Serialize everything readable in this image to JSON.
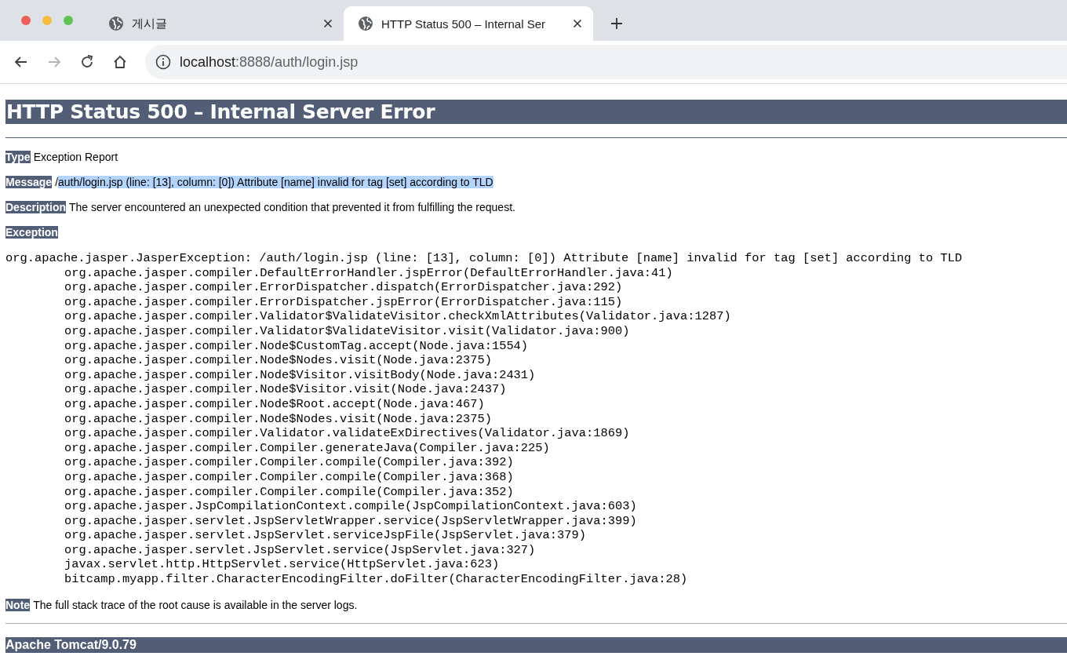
{
  "browser": {
    "tabs": [
      {
        "title": "게시글",
        "selected": false
      },
      {
        "title": "HTTP Status 500 – Internal Ser",
        "selected": true
      }
    ],
    "address": {
      "host": "localhost",
      "path": ":8888/auth/login.jsp"
    }
  },
  "page": {
    "title": "HTTP Status 500 – Internal Server Error",
    "fields": [
      {
        "label": "Type",
        "segments": [
          {
            "text": "Exception Report",
            "selected": false
          }
        ]
      },
      {
        "label": "Message",
        "segments": [
          {
            "text": "/",
            "selected": false
          },
          {
            "text": "auth/login.jsp (line: [13], column: [0]) Attribute [name] invalid for tag [set] according to TLD",
            "selected": true
          }
        ]
      },
      {
        "label": "Description",
        "segments": [
          {
            "text": "The server encountered an unexpected condition that prevented it from fulfilling the request.",
            "selected": false
          }
        ]
      },
      {
        "label": "Exception"
      }
    ],
    "exception": "org.apache.jasper.JasperException: /auth/login.jsp (line: [13], column: [0]) Attribute [name] invalid for tag [set] according to TLD",
    "stack_trace": [
      "org.apache.jasper.compiler.DefaultErrorHandler.jspError(DefaultErrorHandler.java:41)",
      "org.apache.jasper.compiler.ErrorDispatcher.dispatch(ErrorDispatcher.java:292)",
      "org.apache.jasper.compiler.ErrorDispatcher.jspError(ErrorDispatcher.java:115)",
      "org.apache.jasper.compiler.Validator$ValidateVisitor.checkXmlAttributes(Validator.java:1287)",
      "org.apache.jasper.compiler.Validator$ValidateVisitor.visit(Validator.java:900)",
      "org.apache.jasper.compiler.Node$CustomTag.accept(Node.java:1554)",
      "org.apache.jasper.compiler.Node$Nodes.visit(Node.java:2375)",
      "org.apache.jasper.compiler.Node$Visitor.visitBody(Node.java:2431)",
      "org.apache.jasper.compiler.Node$Visitor.visit(Node.java:2437)",
      "org.apache.jasper.compiler.Node$Root.accept(Node.java:467)",
      "org.apache.jasper.compiler.Node$Nodes.visit(Node.java:2375)",
      "org.apache.jasper.compiler.Validator.validateExDirectives(Validator.java:1869)",
      "org.apache.jasper.compiler.Compiler.generateJava(Compiler.java:225)",
      "org.apache.jasper.compiler.Compiler.compile(Compiler.java:392)",
      "org.apache.jasper.compiler.Compiler.compile(Compiler.java:368)",
      "org.apache.jasper.compiler.Compiler.compile(Compiler.java:352)",
      "org.apache.jasper.JspCompilationContext.compile(JspCompilationContext.java:603)",
      "org.apache.jasper.servlet.JspServletWrapper.service(JspServletWrapper.java:399)",
      "org.apache.jasper.servlet.JspServlet.serviceJspFile(JspServlet.java:379)",
      "org.apache.jasper.servlet.JspServlet.service(JspServlet.java:327)",
      "javax.servlet.http.HttpServlet.service(HttpServlet.java:623)",
      "bitcamp.myapp.filter.CharacterEncodingFilter.doFilter(CharacterEncodingFilter.java:28)"
    ],
    "note": {
      "label": "Note",
      "text": "The full stack trace of the root cause is available in the server logs."
    },
    "footer": "Apache Tomcat/9.0.79"
  }
}
